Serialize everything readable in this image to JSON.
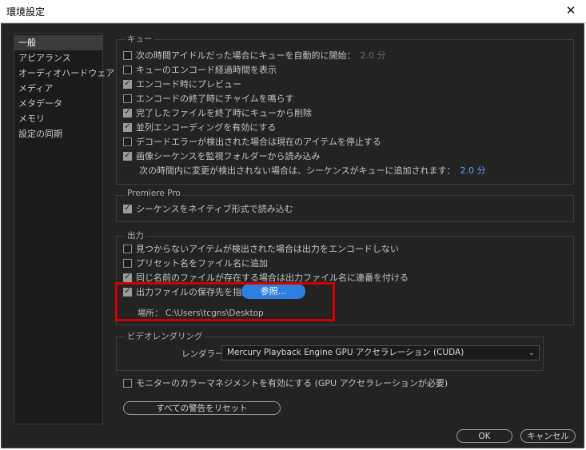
{
  "window": {
    "title": "環境設定",
    "close_icon": "close-icon"
  },
  "sidebar": {
    "items": [
      {
        "label": "一般",
        "active": true
      },
      {
        "label": "アピアランス"
      },
      {
        "label": "オーディオハードウェア"
      },
      {
        "label": "メディア"
      },
      {
        "label": "メタデータ"
      },
      {
        "label": "メモリ"
      },
      {
        "label": "設定の同期"
      }
    ]
  },
  "queue": {
    "title": "キュー",
    "items": [
      {
        "label": "次の時間アイドルだった場合にキューを自動的に開始：",
        "checked": false,
        "value": "2.0 分"
      },
      {
        "label": "キューのエンコード経過時間を表示",
        "checked": false
      },
      {
        "label": "エンコード時にプレビュー",
        "checked": true
      },
      {
        "label": "エンコードの終了時にチャイムを鳴らす",
        "checked": false
      },
      {
        "label": "完了したファイルを終了時にキューから削除",
        "checked": true
      },
      {
        "label": "並列エンコーディングを有効にする",
        "checked": true
      },
      {
        "label": "デコードエラーが検出された場合は現在のアイテムを停止する",
        "checked": false
      },
      {
        "label": "画像シーケンスを監視フォルダーから読み込み",
        "checked": true
      }
    ],
    "idle_note": "次の時間内に変更が検出されない場合は、シーケンスがキューに追加されます：",
    "idle_value": "2.0 分"
  },
  "premiere": {
    "title": "Premiere Pro",
    "items": [
      {
        "label": "シーケンスをネイティブ形式で読み込む",
        "checked": true
      }
    ]
  },
  "output": {
    "title": "出力",
    "items": [
      {
        "label": "見つからないアイテムが検出された場合は出力をエンコードしない",
        "checked": false
      },
      {
        "label": "プリセット名をファイル名に追加",
        "checked": false
      },
      {
        "label": "同じ名前のファイルが存在する場合は出力ファイル名に連番を付ける",
        "checked": true
      },
      {
        "label": "出力ファイルの保存先を指定：",
        "checked": true
      }
    ],
    "browse_label": "参照...",
    "location_label": "場所：",
    "location_path": "C:\\Users\\tcgns\\Desktop"
  },
  "rendering": {
    "title": "ビデオレンダリング",
    "renderer_label": "レンダラー：",
    "renderer_value": "Mercury Playback Engine GPU アクセラレーション (CUDA)"
  },
  "monitor": {
    "label": "モニターのカラーマネジメントを有効にする (GPU アクセラレーションが必要)",
    "checked": false
  },
  "buttons": {
    "reset_warnings": "すべての警告をリセット",
    "ok": "OK",
    "cancel": "キャンセル"
  },
  "colors": {
    "highlight": "#d40000",
    "accent": "#2f7fe0",
    "background": "#232323"
  }
}
